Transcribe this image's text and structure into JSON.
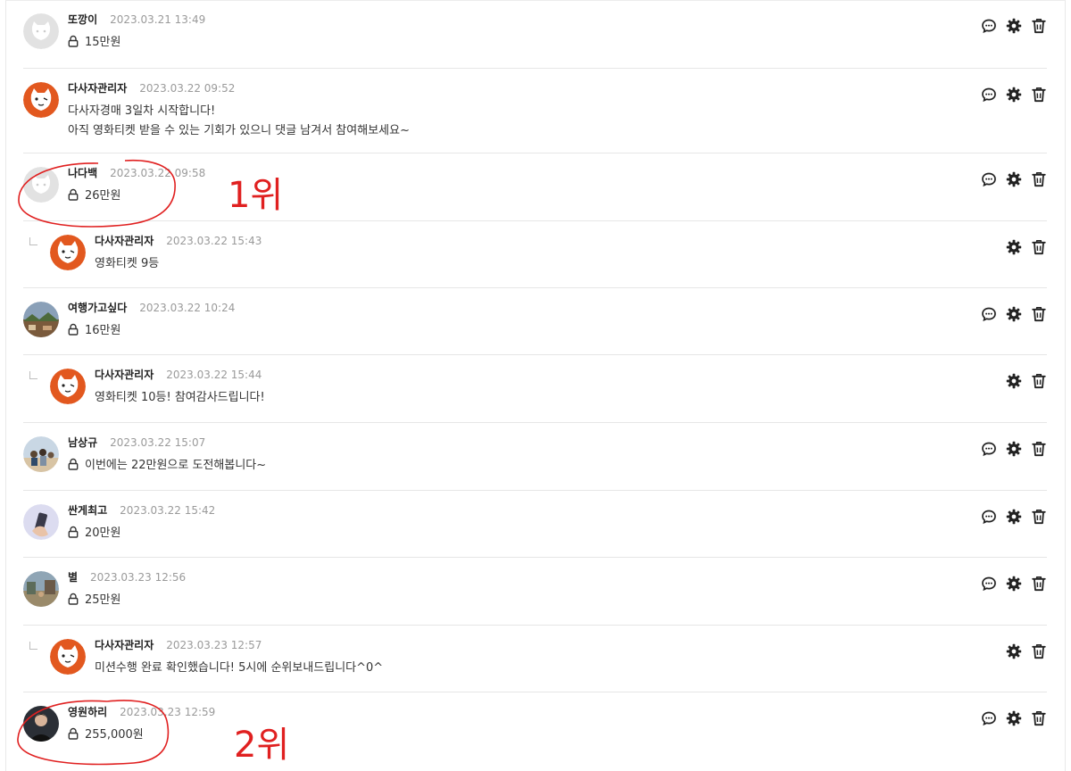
{
  "comments": [
    {
      "nick": "또깡이",
      "date": "2023.03.21 13:49",
      "lines": [
        "15만원"
      ],
      "secret": true,
      "reply": false,
      "avatar": "cat"
    },
    {
      "nick": "다사자관리자",
      "date": "2023.03.22 09:52",
      "lines": [
        "다사자경매 3일차 시작합니다!",
        "아직 영화티켓 받을 수 있는 기회가 있으니 댓글 남겨서 참여해보세요~"
      ],
      "secret": false,
      "reply": false,
      "avatar": "admin"
    },
    {
      "nick": "나다백",
      "date": "2023.03.22 09:58",
      "lines": [
        "26만원"
      ],
      "secret": true,
      "reply": false,
      "avatar": "cat"
    },
    {
      "nick": "다사자관리자",
      "date": "2023.03.22 15:43",
      "lines": [
        "영화티켓 9등"
      ],
      "secret": false,
      "reply": true,
      "avatar": "admin"
    },
    {
      "nick": "여행가고싶다",
      "date": "2023.03.22 10:24",
      "lines": [
        "16만원"
      ],
      "secret": true,
      "reply": false,
      "avatar": "photo-landscape"
    },
    {
      "nick": "다사자관리자",
      "date": "2023.03.22 15:44",
      "lines": [
        "영화티켓 10등! 참여감사드립니다!"
      ],
      "secret": false,
      "reply": true,
      "avatar": "admin"
    },
    {
      "nick": "남상규",
      "date": "2023.03.22 15:07",
      "lines": [
        "이번에는 22만원으로 도전해봅니다~"
      ],
      "secret": true,
      "reply": false,
      "avatar": "photo-group"
    },
    {
      "nick": "싼게최고",
      "date": "2023.03.22 15:42",
      "lines": [
        "20만원"
      ],
      "secret": true,
      "reply": false,
      "avatar": "photo-hand"
    },
    {
      "nick": "별",
      "date": "2023.03.23 12:56",
      "lines": [
        "25만원"
      ],
      "secret": true,
      "reply": false,
      "avatar": "photo-street"
    },
    {
      "nick": "다사자관리자",
      "date": "2023.03.23 12:57",
      "lines": [
        "미션수행 완료 확인했습니다! 5시에 순위보내드립니다^0^"
      ],
      "secret": false,
      "reply": true,
      "avatar": "admin"
    },
    {
      "nick": "영원하리",
      "date": "2023.03.23 12:59",
      "lines": [
        "255,000원"
      ],
      "secret": true,
      "reply": false,
      "avatar": "photo-person"
    }
  ],
  "annotations": {
    "first": "1위",
    "second": "2위",
    "color": "#e02020"
  },
  "icons": {
    "reply": "speech-bubble-icon",
    "settings": "gear-icon",
    "delete": "trash-icon",
    "lock": "lock-icon"
  },
  "colors": {
    "admin_orange": "#e2581f",
    "divider": "#e6e6e6",
    "date_gray": "#9a9a9a"
  }
}
